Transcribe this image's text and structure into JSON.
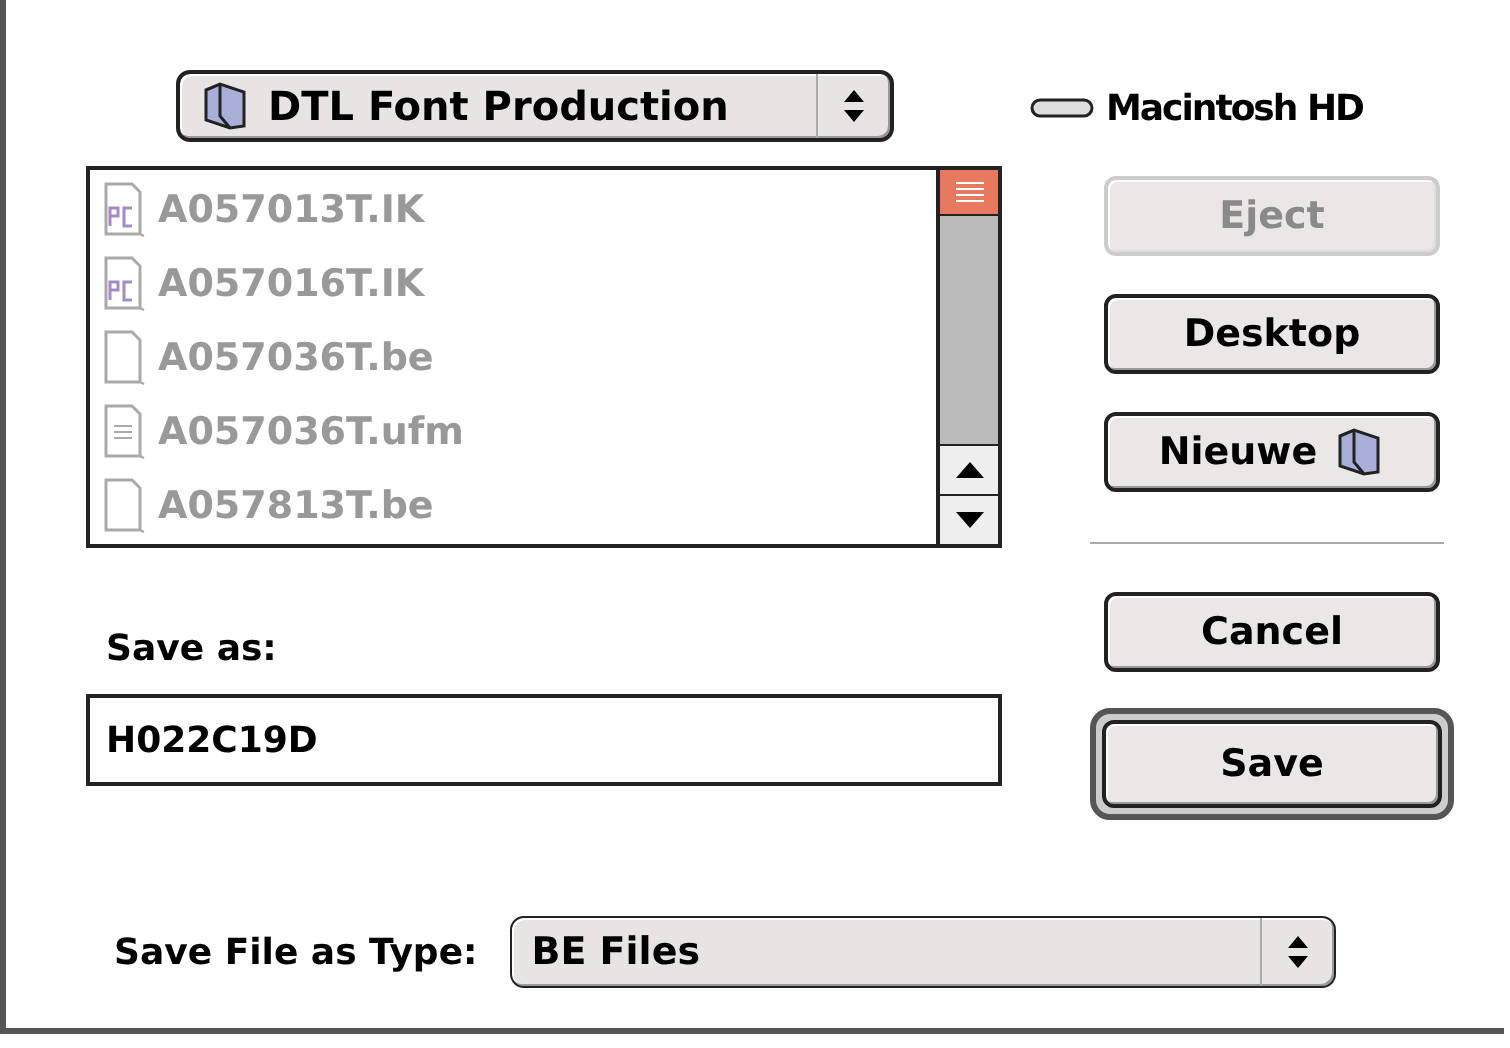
{
  "folder_popup": {
    "label": "DTL Font Production"
  },
  "disk": {
    "label": "Macintosh HD"
  },
  "files": [
    {
      "name": "A057013T.IK",
      "kind": "pc",
      "disabled": true
    },
    {
      "name": "A057016T.IK",
      "kind": "pc",
      "disabled": true
    },
    {
      "name": "A057036T.be",
      "kind": "doc",
      "disabled": true
    },
    {
      "name": "A057036T.ufm",
      "kind": "text",
      "disabled": true
    },
    {
      "name": "A057813T.be",
      "kind": "doc",
      "disabled": true
    }
  ],
  "buttons": [
    {
      "label": "Eject",
      "disabled": true,
      "kind": "plain"
    },
    {
      "label": "Desktop",
      "disabled": false,
      "kind": "plain"
    },
    {
      "label": "Nieuwe",
      "disabled": false,
      "kind": "folder"
    }
  ],
  "cancel": {
    "label": "Cancel"
  },
  "save": {
    "label": "Save",
    "default": true
  },
  "save_as": {
    "label": "Save as:",
    "value": "H022C19D"
  },
  "type": {
    "label": "Save File as Type:",
    "value": "BE Files"
  }
}
